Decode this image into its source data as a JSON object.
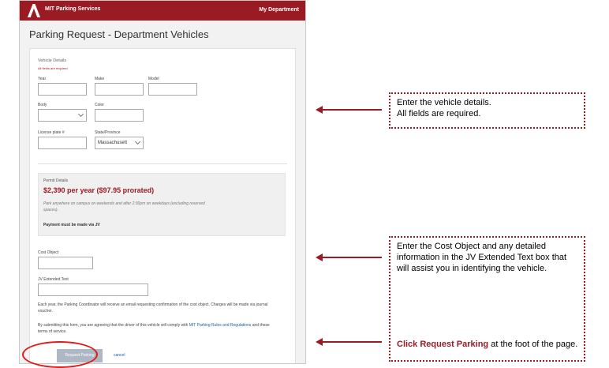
{
  "header": {
    "brand": "MIT Parking Services",
    "department_link": "My Department"
  },
  "page": {
    "title": "Parking Request - Department Vehicles"
  },
  "vehicle": {
    "section_label": "Vehicle Details",
    "required_note": "All fields are required",
    "year_label": "Year",
    "make_label": "Make",
    "model_label": "Model",
    "body_label": "Body",
    "color_label": "Color",
    "plate_label": "License plate #",
    "state_label": "State/Province",
    "state_value": "Massachusett"
  },
  "permit": {
    "label": "Permit Details",
    "price": "$2,390 per year  ($97.95 prorated)",
    "note": "Park anywhere on campus on weekends and after 2:30pm on weekdays (excluding reserved spaces).",
    "payment": "Payment must be made via JV"
  },
  "accounting": {
    "cost_object_label": "Cost Object",
    "jv_label": "JV Extended Text",
    "confirmation_text": "Each year, the Parking Coordinator will receive an email requesting confirmation of the cost object. Charges will be made via journal voucher.",
    "agree_prefix": "By submitting this form, you are agreeing that the driver of this vehicle will comply with",
    "agree_link": "MIT Parking Rules and Regulations",
    "agree_suffix": "and these terms of service."
  },
  "actions": {
    "submit_label": "Request Parking",
    "cancel_label": "cancel"
  },
  "callouts": {
    "vehicle": {
      "line1": "Enter the vehicle details.",
      "line2": "All fields are required."
    },
    "cost": {
      "text": "Enter the Cost Object and any detailed information in the JV Extended Text box that will assist you in identifying the vehicle."
    },
    "submit": {
      "bold": "Click Request Parking",
      "rest": " at the foot of the page."
    }
  },
  "colors": {
    "brand": "#9b1b24",
    "button": "#aeb8c5",
    "link": "#1a5fa0",
    "ring": "#e01a1a"
  }
}
